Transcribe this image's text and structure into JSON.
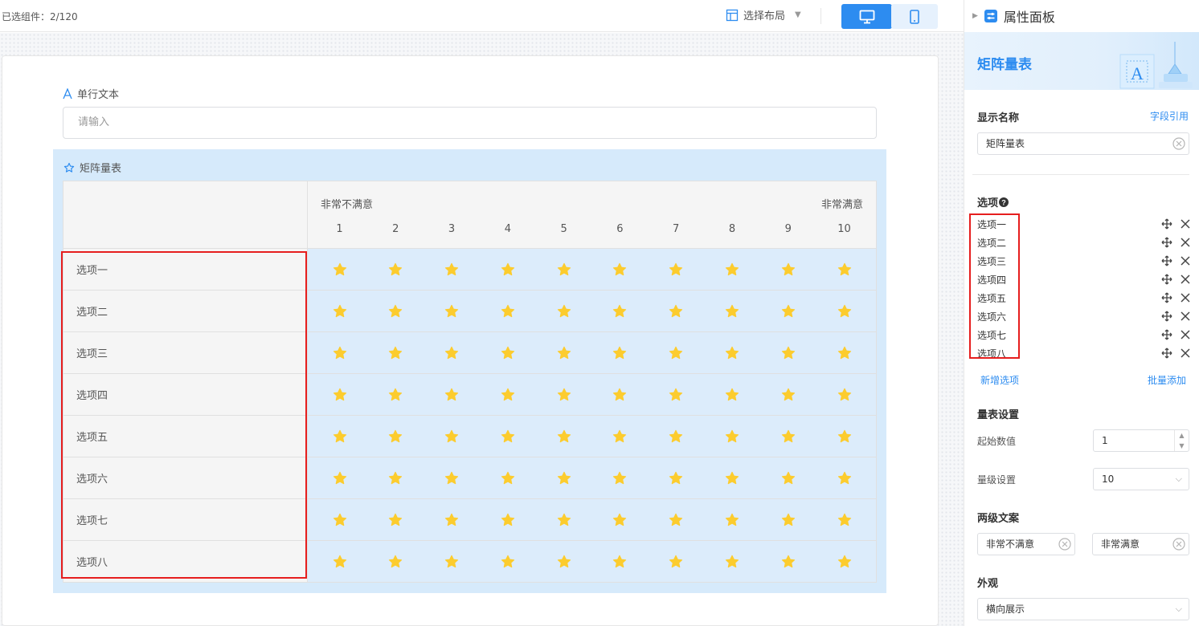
{
  "topbar": {
    "selected_count": "已选组件：2/120",
    "layout_label": "选择布局",
    "device_desktop": "desktop-icon",
    "device_mobile": "mobile-icon"
  },
  "form": {
    "text_field": {
      "label": "单行文本",
      "placeholder": "请输入"
    },
    "matrix": {
      "label": "矩阵量表",
      "scale_low": "非常不满意",
      "scale_high": "非常满意",
      "scale_numbers": [
        "1",
        "2",
        "3",
        "4",
        "5",
        "6",
        "7",
        "8",
        "9",
        "10"
      ],
      "rows": [
        "选项一",
        "选项二",
        "选项三",
        "选项四",
        "选项五",
        "选项六",
        "选项七",
        "选项八"
      ],
      "star_color": "#fccc2e"
    }
  },
  "panel": {
    "title": "属性面板",
    "component_title": "矩阵量表",
    "display_name_label": "显示名称",
    "field_ref_link": "字段引用",
    "display_name_value": "矩阵量表",
    "options_label": "选项",
    "options": [
      "选项一",
      "选项二",
      "选项三",
      "选项四",
      "选项五",
      "选项六",
      "选项七",
      "选项八"
    ],
    "add_option": "新增选项",
    "batch_add": "批量添加",
    "scale_settings_label": "量表设置",
    "start_value_label": "起始数值",
    "start_value": "1",
    "level_label": "量级设置",
    "level_value": "10",
    "two_level_label": "两级文案",
    "low_text": "非常不满意",
    "high_text": "非常满意",
    "appearance_label": "外观",
    "appearance_value": "横向展示"
  },
  "colors": {
    "accent": "#2d8cf0",
    "highlight": "#e61e1e",
    "matrix_bg": "#d6eafb"
  }
}
